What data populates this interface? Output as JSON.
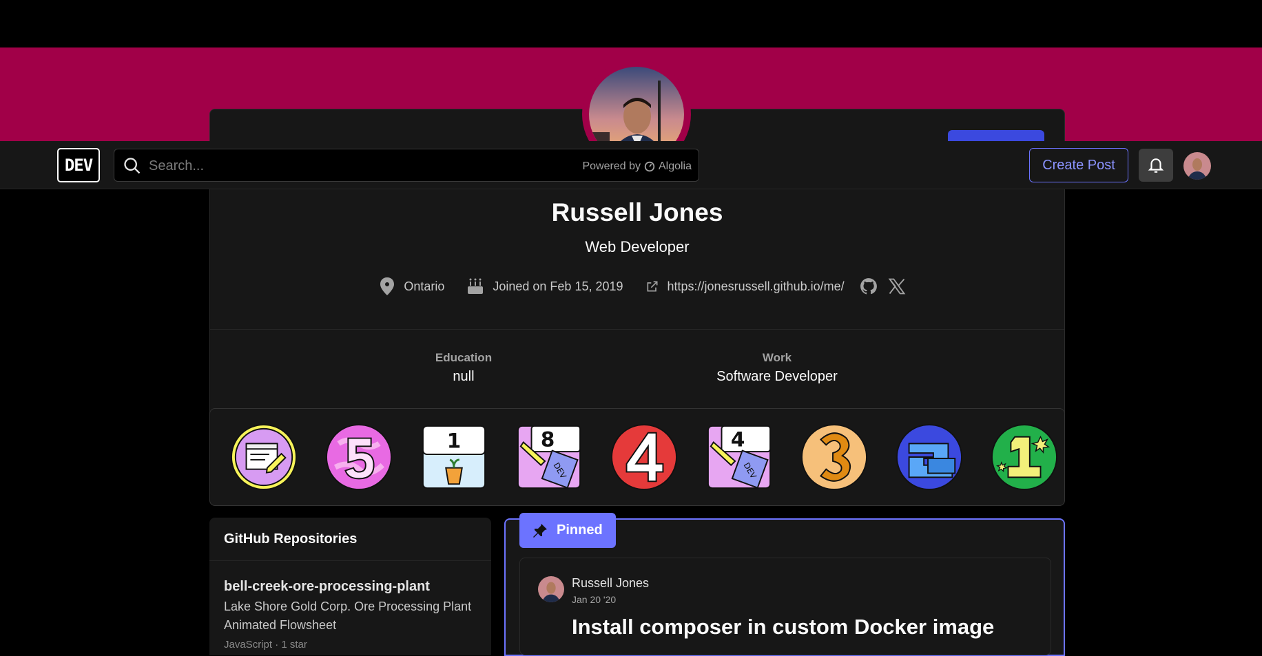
{
  "header": {
    "logo_text": "DEV",
    "search_placeholder": "Search...",
    "powered_by": "Powered by",
    "algolia": "Algolia",
    "create_post": "Create Post"
  },
  "profile": {
    "name": "Russell Jones",
    "bio": "Web Developer",
    "location": "Ontario",
    "joined": "Joined on Feb 15, 2019",
    "website": "https://jonesrussell.github.io/me/",
    "education_label": "Education",
    "education_value": "null",
    "work_label": "Work",
    "work_value": "Software Developer",
    "brand_color": "#a10048"
  },
  "badges": [
    {
      "icon": "writing-debut-badge"
    },
    {
      "icon": "five-year-club-badge"
    },
    {
      "icon": "one-year-club-badge"
    },
    {
      "icon": "eight-week-streak-badge"
    },
    {
      "icon": "four-year-club-badge"
    },
    {
      "icon": "four-week-streak-badge"
    },
    {
      "icon": "three-year-club-badge"
    },
    {
      "icon": "two-year-club-badge"
    },
    {
      "icon": "one-week-streak-badge"
    }
  ],
  "github": {
    "title": "GitHub Repositories",
    "repos": [
      {
        "name": "bell-creek-ore-processing-plant",
        "description": "Lake Shore Gold Corp. Ore Processing Plant Animated Flowsheet",
        "meta": "JavaScript · 1 star"
      }
    ]
  },
  "pinned": {
    "label": "Pinned",
    "author": "Russell Jones",
    "date": "Jan 20 '20",
    "title": "Install composer in custom Docker image"
  },
  "colors": {
    "accent": "#6c73ff",
    "primary_button": "#3b49df"
  }
}
